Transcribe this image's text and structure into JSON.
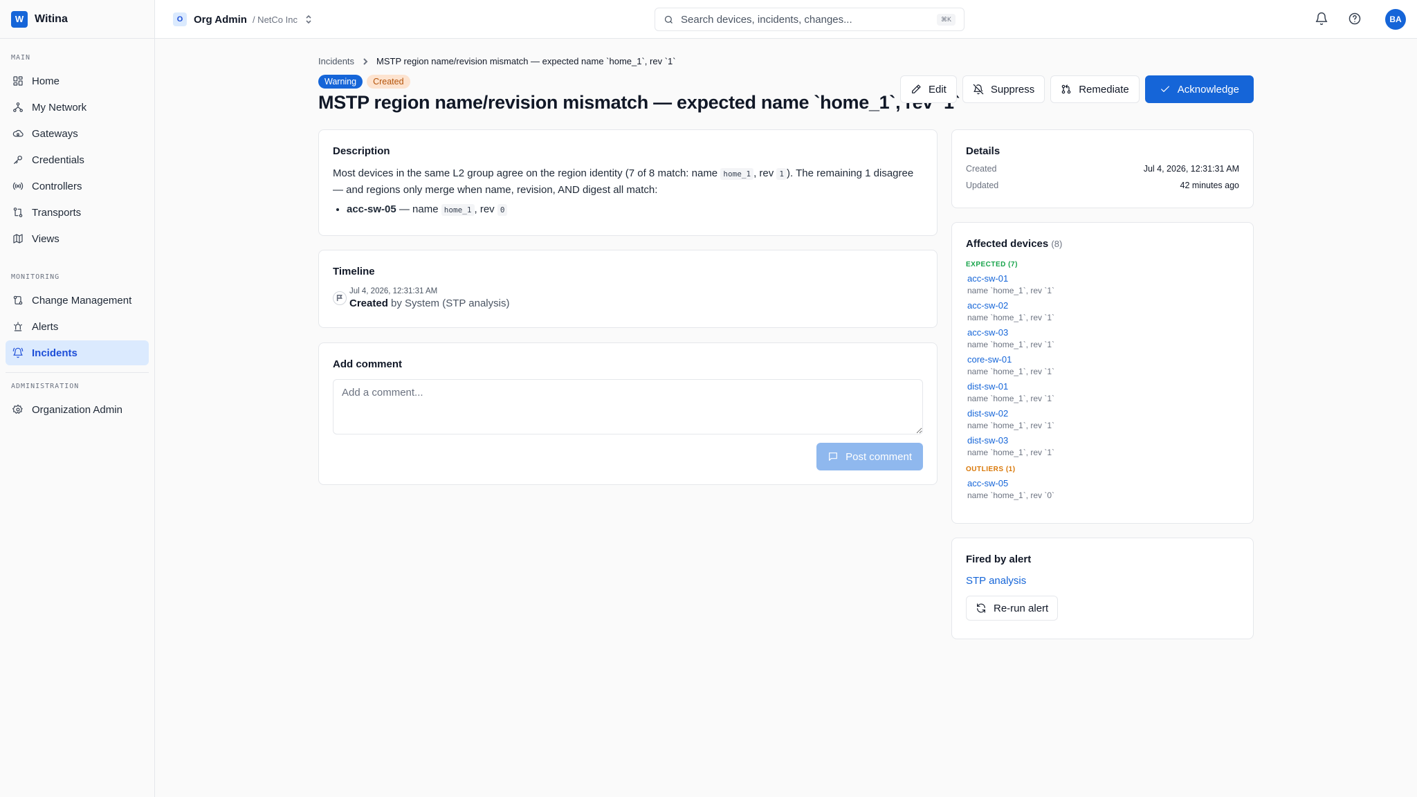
{
  "app": {
    "logo_letter": "W",
    "name": "Witina"
  },
  "org": {
    "badge_letter": "O",
    "name": "Org Admin",
    "sub": "/ NetCo Inc"
  },
  "search": {
    "placeholder": "Search devices, incidents, changes...",
    "shortcut": "⌘K"
  },
  "user": {
    "initials": "BA"
  },
  "sidebar": {
    "sections": [
      {
        "label": "MAIN",
        "items": [
          {
            "label": "Home",
            "icon": "home-grid-icon"
          },
          {
            "label": "My Network",
            "icon": "network-icon"
          },
          {
            "label": "Gateways",
            "icon": "cloud-gateway-icon"
          },
          {
            "label": "Credentials",
            "icon": "key-icon"
          },
          {
            "label": "Controllers",
            "icon": "radio-waves-icon"
          },
          {
            "label": "Transports",
            "icon": "transport-icon"
          },
          {
            "label": "Views",
            "icon": "map-icon"
          }
        ]
      },
      {
        "label": "MONITORING",
        "items": [
          {
            "label": "Change Management",
            "icon": "git-compare-icon"
          },
          {
            "label": "Alerts",
            "icon": "siren-icon"
          },
          {
            "label": "Incidents",
            "icon": "bell-ring-icon",
            "active": true
          }
        ]
      },
      {
        "label": "ADMINISTRATION",
        "items": [
          {
            "label": "Organization Admin",
            "icon": "gear-icon"
          }
        ]
      }
    ]
  },
  "breadcrumb": {
    "parent": "Incidents",
    "current": "MSTP region name/revision mismatch — expected name `home_1`, rev `1`"
  },
  "badges": {
    "severity": "Warning",
    "status": "Created"
  },
  "title": "MSTP region name/revision mismatch — expected name `home_1`, rev `1`",
  "actions": {
    "edit": "Edit",
    "suppress": "Suppress",
    "remediate": "Remediate",
    "acknowledge": "Acknowledge"
  },
  "description": {
    "title": "Description",
    "p1": "Most devices in the same L2 group agree on the region identity (7 of 8 match: name ",
    "p1_code1": "home_1",
    "p1_mid": ", rev ",
    "p1_code2": "1",
    "p1_end": "). The remaining 1 disagree — and regions only merge when name, revision, AND digest all match:",
    "item_device": "acc-sw-05",
    "item_sep": " — name ",
    "item_code1": "home_1",
    "item_mid": ", rev ",
    "item_code2": "0"
  },
  "timeline": {
    "title": "Timeline",
    "time": "Jul 4, 2026, 12:31:31 AM",
    "event_action": "Created",
    "event_rest": " by System (STP analysis)"
  },
  "comment": {
    "title": "Add comment",
    "placeholder": "Add a comment...",
    "post_label": "Post comment"
  },
  "details": {
    "title": "Details",
    "created_label": "Created",
    "created_value": "Jul 4, 2026, 12:31:31 AM",
    "updated_label": "Updated",
    "updated_value": "42 minutes ago"
  },
  "affected": {
    "title": "Affected devices",
    "count": "(8)",
    "expected_label": "EXPECTED (7)",
    "expected": [
      {
        "name": "acc-sw-01",
        "meta": "name `home_1`, rev `1`"
      },
      {
        "name": "acc-sw-02",
        "meta": "name `home_1`, rev `1`"
      },
      {
        "name": "acc-sw-03",
        "meta": "name `home_1`, rev `1`"
      },
      {
        "name": "core-sw-01",
        "meta": "name `home_1`, rev `1`"
      },
      {
        "name": "dist-sw-01",
        "meta": "name `home_1`, rev `1`"
      },
      {
        "name": "dist-sw-02",
        "meta": "name `home_1`, rev `1`"
      },
      {
        "name": "dist-sw-03",
        "meta": "name `home_1`, rev `1`"
      }
    ],
    "outliers_label": "OUTLIERS (1)",
    "outliers": [
      {
        "name": "acc-sw-05",
        "meta": "name `home_1`, rev `0`"
      }
    ]
  },
  "fired_by": {
    "title": "Fired by alert",
    "alert_name": "STP analysis",
    "rerun_label": "Re-run alert"
  },
  "colors": {
    "accent": "#1565d8",
    "expected": "#16a34a",
    "outliers": "#d97706",
    "created_badge_bg": "#fde3cf"
  }
}
